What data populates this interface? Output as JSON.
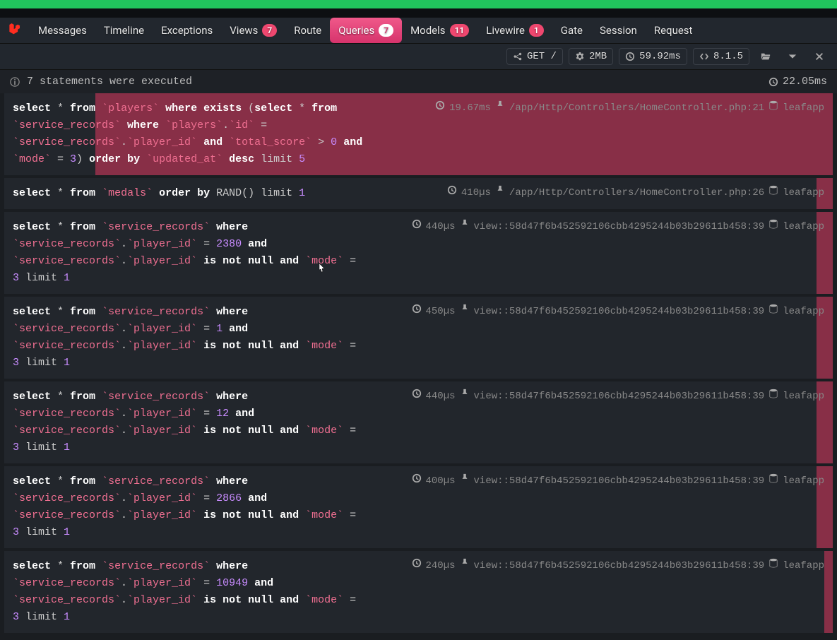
{
  "tabs": [
    {
      "label": "Messages"
    },
    {
      "label": "Timeline"
    },
    {
      "label": "Exceptions"
    },
    {
      "label": "Views",
      "badge": "7"
    },
    {
      "label": "Route"
    },
    {
      "label": "Queries",
      "badge": "7",
      "active": true
    },
    {
      "label": "Models",
      "badge": "11"
    },
    {
      "label": "Livewire",
      "badge": "1"
    },
    {
      "label": "Gate"
    },
    {
      "label": "Session"
    },
    {
      "label": "Request"
    }
  ],
  "status": {
    "method": "GET /",
    "memory": "2MB",
    "time": "59.92ms",
    "version": "8.1.5"
  },
  "summary": {
    "text": "7 statements were executed",
    "total_time": "22.05ms"
  },
  "connection_label": "leafapp",
  "queries": [
    {
      "sql": [
        {
          "t": "kw",
          "v": "select"
        },
        {
          "t": "",
          "v": " * "
        },
        {
          "t": "kw",
          "v": "from"
        },
        {
          "t": "",
          "v": " "
        },
        {
          "t": "tbl",
          "v": "`players`"
        },
        {
          "t": "",
          "v": " "
        },
        {
          "t": "kw",
          "v": "where exists"
        },
        {
          "t": "",
          "v": " ("
        },
        {
          "t": "kw",
          "v": "select"
        },
        {
          "t": "",
          "v": " * "
        },
        {
          "t": "kw",
          "v": "from"
        },
        {
          "t": "",
          "v": " "
        },
        {
          "t": "tbl",
          "v": "`service_records`"
        },
        {
          "t": "",
          "v": " "
        },
        {
          "t": "kw",
          "v": "where"
        },
        {
          "t": "",
          "v": " "
        },
        {
          "t": "tbl",
          "v": "`players`"
        },
        {
          "t": "",
          "v": "."
        },
        {
          "t": "tbl",
          "v": "`id`"
        },
        {
          "t": "",
          "v": " = "
        },
        {
          "t": "tbl",
          "v": "`service_records`"
        },
        {
          "t": "",
          "v": "."
        },
        {
          "t": "tbl",
          "v": "`player_id`"
        },
        {
          "t": "",
          "v": " "
        },
        {
          "t": "kw",
          "v": "and"
        },
        {
          "t": "",
          "v": " "
        },
        {
          "t": "tbl",
          "v": "`total_score`"
        },
        {
          "t": "",
          "v": " > "
        },
        {
          "t": "num",
          "v": "0"
        },
        {
          "t": "",
          "v": " "
        },
        {
          "t": "kw",
          "v": "and"
        },
        {
          "t": "",
          "v": " "
        },
        {
          "t": "tbl",
          "v": "`mode`"
        },
        {
          "t": "",
          "v": " = "
        },
        {
          "t": "num",
          "v": "3"
        },
        {
          "t": "",
          "v": ") "
        },
        {
          "t": "kw",
          "v": "order by"
        },
        {
          "t": "",
          "v": " "
        },
        {
          "t": "tbl",
          "v": "`updated_at`"
        },
        {
          "t": "",
          "v": " "
        },
        {
          "t": "kw",
          "v": "desc"
        },
        {
          "t": "",
          "v": " limit "
        },
        {
          "t": "num",
          "v": "5"
        }
      ],
      "duration": "19.67ms",
      "source": "/app/Http/Controllers/HomeController.php:21",
      "bar_pct": 89
    },
    {
      "sql": [
        {
          "t": "kw",
          "v": "select"
        },
        {
          "t": "",
          "v": " * "
        },
        {
          "t": "kw",
          "v": "from"
        },
        {
          "t": "",
          "v": " "
        },
        {
          "t": "tbl",
          "v": "`medals`"
        },
        {
          "t": "",
          "v": " "
        },
        {
          "t": "kw",
          "v": "order by"
        },
        {
          "t": "",
          "v": " RAND() limit "
        },
        {
          "t": "num",
          "v": "1"
        }
      ],
      "duration": "410µs",
      "source": "/app/Http/Controllers/HomeController.php:26",
      "bar_pct": 2
    },
    {
      "sql": [
        {
          "t": "kw",
          "v": "select"
        },
        {
          "t": "",
          "v": " * "
        },
        {
          "t": "kw",
          "v": "from"
        },
        {
          "t": "",
          "v": " "
        },
        {
          "t": "tbl",
          "v": "`service_records`"
        },
        {
          "t": "",
          "v": " "
        },
        {
          "t": "kw",
          "v": "where"
        },
        {
          "t": "",
          "v": " "
        },
        {
          "t": "tbl",
          "v": "`service_records`"
        },
        {
          "t": "",
          "v": "."
        },
        {
          "t": "tbl",
          "v": "`player_id`"
        },
        {
          "t": "",
          "v": " = "
        },
        {
          "t": "num",
          "v": "2380"
        },
        {
          "t": "",
          "v": " "
        },
        {
          "t": "kw",
          "v": "and"
        },
        {
          "t": "",
          "v": " "
        },
        {
          "t": "tbl",
          "v": "`service_records`"
        },
        {
          "t": "",
          "v": "."
        },
        {
          "t": "tbl",
          "v": "`player_id`"
        },
        {
          "t": "",
          "v": " "
        },
        {
          "t": "kw",
          "v": "is not null and"
        },
        {
          "t": "",
          "v": " "
        },
        {
          "t": "tbl",
          "v": "`mode`"
        },
        {
          "t": "",
          "v": " = "
        },
        {
          "t": "num",
          "v": "3"
        },
        {
          "t": "",
          "v": " limit "
        },
        {
          "t": "num",
          "v": "1"
        }
      ],
      "duration": "440µs",
      "source": "view::58d47f6b452592106cbb4295244b03b29611b458:39",
      "bar_pct": 2
    },
    {
      "sql": [
        {
          "t": "kw",
          "v": "select"
        },
        {
          "t": "",
          "v": " * "
        },
        {
          "t": "kw",
          "v": "from"
        },
        {
          "t": "",
          "v": " "
        },
        {
          "t": "tbl",
          "v": "`service_records`"
        },
        {
          "t": "",
          "v": " "
        },
        {
          "t": "kw",
          "v": "where"
        },
        {
          "t": "",
          "v": " "
        },
        {
          "t": "tbl",
          "v": "`service_records`"
        },
        {
          "t": "",
          "v": "."
        },
        {
          "t": "tbl",
          "v": "`player_id`"
        },
        {
          "t": "",
          "v": " = "
        },
        {
          "t": "num",
          "v": "1"
        },
        {
          "t": "",
          "v": " "
        },
        {
          "t": "kw",
          "v": "and"
        },
        {
          "t": "",
          "v": " "
        },
        {
          "t": "tbl",
          "v": "`service_records`"
        },
        {
          "t": "",
          "v": "."
        },
        {
          "t": "tbl",
          "v": "`player_id`"
        },
        {
          "t": "",
          "v": " "
        },
        {
          "t": "kw",
          "v": "is not null and"
        },
        {
          "t": "",
          "v": " "
        },
        {
          "t": "tbl",
          "v": "`mode`"
        },
        {
          "t": "",
          "v": " = "
        },
        {
          "t": "num",
          "v": "3"
        },
        {
          "t": "",
          "v": " limit "
        },
        {
          "t": "num",
          "v": "1"
        }
      ],
      "duration": "450µs",
      "source": "view::58d47f6b452592106cbb4295244b03b29611b458:39",
      "bar_pct": 2
    },
    {
      "sql": [
        {
          "t": "kw",
          "v": "select"
        },
        {
          "t": "",
          "v": " * "
        },
        {
          "t": "kw",
          "v": "from"
        },
        {
          "t": "",
          "v": " "
        },
        {
          "t": "tbl",
          "v": "`service_records`"
        },
        {
          "t": "",
          "v": " "
        },
        {
          "t": "kw",
          "v": "where"
        },
        {
          "t": "",
          "v": " "
        },
        {
          "t": "tbl",
          "v": "`service_records`"
        },
        {
          "t": "",
          "v": "."
        },
        {
          "t": "tbl",
          "v": "`player_id`"
        },
        {
          "t": "",
          "v": " = "
        },
        {
          "t": "num",
          "v": "12"
        },
        {
          "t": "",
          "v": " "
        },
        {
          "t": "kw",
          "v": "and"
        },
        {
          "t": "",
          "v": " "
        },
        {
          "t": "tbl",
          "v": "`service_records`"
        },
        {
          "t": "",
          "v": "."
        },
        {
          "t": "tbl",
          "v": "`player_id`"
        },
        {
          "t": "",
          "v": " "
        },
        {
          "t": "kw",
          "v": "is not null and"
        },
        {
          "t": "",
          "v": " "
        },
        {
          "t": "tbl",
          "v": "`mode`"
        },
        {
          "t": "",
          "v": " = "
        },
        {
          "t": "num",
          "v": "3"
        },
        {
          "t": "",
          "v": " limit "
        },
        {
          "t": "num",
          "v": "1"
        }
      ],
      "duration": "440µs",
      "source": "view::58d47f6b452592106cbb4295244b03b29611b458:39",
      "bar_pct": 2
    },
    {
      "sql": [
        {
          "t": "kw",
          "v": "select"
        },
        {
          "t": "",
          "v": " * "
        },
        {
          "t": "kw",
          "v": "from"
        },
        {
          "t": "",
          "v": " "
        },
        {
          "t": "tbl",
          "v": "`service_records`"
        },
        {
          "t": "",
          "v": " "
        },
        {
          "t": "kw",
          "v": "where"
        },
        {
          "t": "",
          "v": " "
        },
        {
          "t": "tbl",
          "v": "`service_records`"
        },
        {
          "t": "",
          "v": "."
        },
        {
          "t": "tbl",
          "v": "`player_id`"
        },
        {
          "t": "",
          "v": " = "
        },
        {
          "t": "num",
          "v": "2866"
        },
        {
          "t": "",
          "v": " "
        },
        {
          "t": "kw",
          "v": "and"
        },
        {
          "t": "",
          "v": " "
        },
        {
          "t": "tbl",
          "v": "`service_records`"
        },
        {
          "t": "",
          "v": "."
        },
        {
          "t": "tbl",
          "v": "`player_id`"
        },
        {
          "t": "",
          "v": " "
        },
        {
          "t": "kw",
          "v": "is not null and"
        },
        {
          "t": "",
          "v": " "
        },
        {
          "t": "tbl",
          "v": "`mode`"
        },
        {
          "t": "",
          "v": " = "
        },
        {
          "t": "num",
          "v": "3"
        },
        {
          "t": "",
          "v": " limit "
        },
        {
          "t": "num",
          "v": "1"
        }
      ],
      "duration": "400µs",
      "source": "view::58d47f6b452592106cbb4295244b03b29611b458:39",
      "bar_pct": 2
    },
    {
      "sql": [
        {
          "t": "kw",
          "v": "select"
        },
        {
          "t": "",
          "v": " * "
        },
        {
          "t": "kw",
          "v": "from"
        },
        {
          "t": "",
          "v": " "
        },
        {
          "t": "tbl",
          "v": "`service_records`"
        },
        {
          "t": "",
          "v": " "
        },
        {
          "t": "kw",
          "v": "where"
        },
        {
          "t": "",
          "v": " "
        },
        {
          "t": "tbl",
          "v": "`service_records`"
        },
        {
          "t": "",
          "v": "."
        },
        {
          "t": "tbl",
          "v": "`player_id`"
        },
        {
          "t": "",
          "v": " = "
        },
        {
          "t": "num",
          "v": "10949"
        },
        {
          "t": "",
          "v": " "
        },
        {
          "t": "kw",
          "v": "and"
        },
        {
          "t": "",
          "v": " "
        },
        {
          "t": "tbl",
          "v": "`service_records`"
        },
        {
          "t": "",
          "v": "."
        },
        {
          "t": "tbl",
          "v": "`player_id`"
        },
        {
          "t": "",
          "v": " "
        },
        {
          "t": "kw",
          "v": "is not null and"
        },
        {
          "t": "",
          "v": " "
        },
        {
          "t": "tbl",
          "v": "`mode`"
        },
        {
          "t": "",
          "v": " = "
        },
        {
          "t": "num",
          "v": "3"
        },
        {
          "t": "",
          "v": " limit "
        },
        {
          "t": "num",
          "v": "1"
        }
      ],
      "duration": "240µs",
      "source": "view::58d47f6b452592106cbb4295244b03b29611b458:39",
      "bar_pct": 1
    }
  ]
}
